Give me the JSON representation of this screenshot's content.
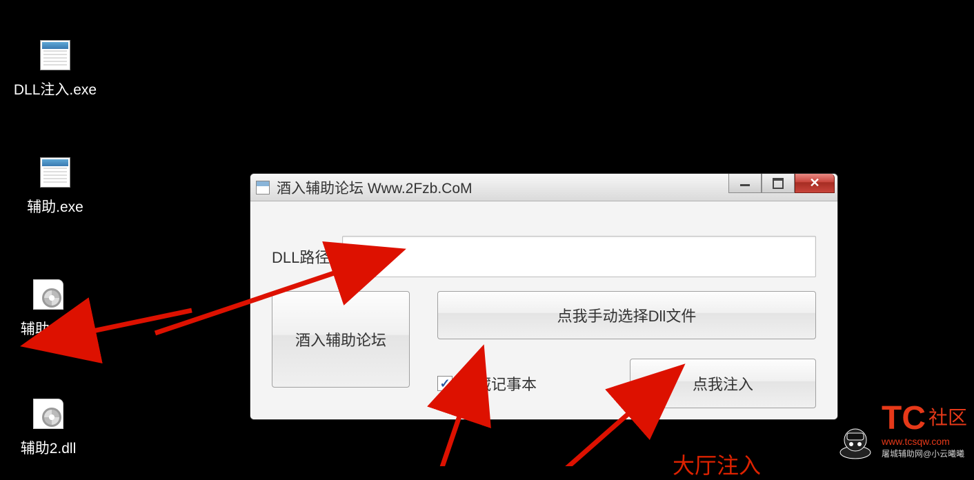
{
  "desktop": {
    "icons": [
      {
        "label": "DLL注入.exe",
        "type": "exe"
      },
      {
        "label": "辅助.exe",
        "type": "exe"
      },
      {
        "label": "辅助1.dll",
        "type": "dll"
      },
      {
        "label": "辅助2.dll",
        "type": "dll"
      }
    ]
  },
  "window": {
    "title": "酒入辅助论坛 Www.2Fzb.CoM",
    "dll_path_label": "DLL路径:",
    "dll_path_value": "",
    "select_dll_button": "点我手动选择Dll文件",
    "forum_button": "酒入辅助论坛",
    "hide_notepad_label": "隐藏记事本",
    "hide_notepad_checked": true,
    "inject_button": "点我注入"
  },
  "annotation": {
    "bottom_cutoff": "大厅注入"
  },
  "watermark": {
    "logo": "TC",
    "badge": "社区",
    "url": "www.tcsqw.com",
    "subtitle": "屠城辅助网@小云曦曦"
  }
}
